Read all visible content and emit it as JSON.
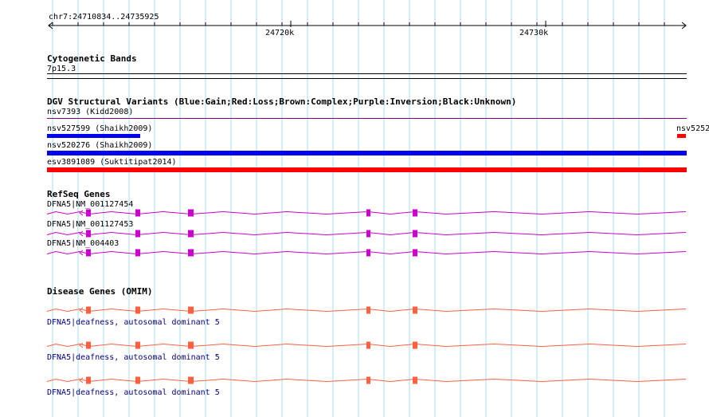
{
  "ruler": {
    "coords": "chr7:24710834..24735925",
    "ticks": [
      "24720k",
      "24730k"
    ]
  },
  "tracks": {
    "cyto": {
      "title": "Cytogenetic Bands",
      "band": "7p15.3"
    },
    "dgv": {
      "title": "DGV Structural Variants (Blue:Gain;Red:Loss;Brown:Complex;Purple:Inversion;Black:Unknown)",
      "features": [
        {
          "label": "nsv7393 (Kidd2008)",
          "color": "#800080"
        },
        {
          "label": "nsv527599 (Shaikh2009)",
          "color": "#0000ee"
        },
        {
          "label": "nsv5252",
          "color": "#ff0000"
        },
        {
          "label": "nsv520276 (Shaikh2009)",
          "color": "#0000ee"
        },
        {
          "label": "esv3891089 (Suktitipat2014)",
          "color": "#ff0000"
        }
      ]
    },
    "refseq": {
      "title": "RefSeq Genes",
      "color": "#cc00cc",
      "transcripts": [
        "DFNA5|NM_001127454",
        "DFNA5|NM_001127453",
        "DFNA5|NM_004403"
      ]
    },
    "omim": {
      "title": "Disease Genes (OMIM)",
      "color": "#ff6040",
      "entries": [
        "DFNA5|deafness, autosomal dominant 5",
        "DFNA5|deafness, autosomal dominant 5",
        "DFNA5|deafness, autosomal dominant 5"
      ]
    }
  }
}
